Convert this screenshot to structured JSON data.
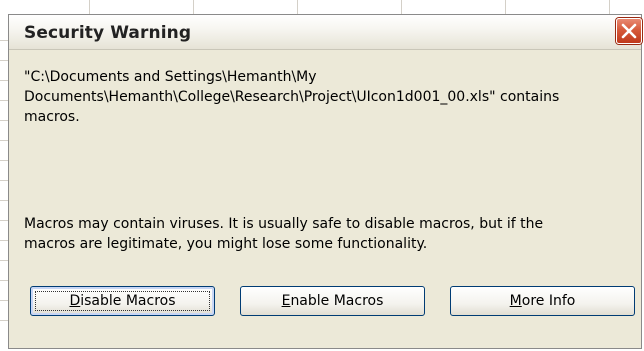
{
  "dialog": {
    "title": "Security Warning",
    "message": "\"C:\\Documents and Settings\\Hemanth\\My Documents\\Hemanth\\College\\Research\\Project\\UIcon1d001_00.xls\" contains macros.",
    "message_lines": [
      "\"C:\\Documents and Settings\\Hemanth\\My",
      "Documents\\Hemanth\\College\\Research\\Project\\UIcon1d001_00.xls\" contains",
      "macros."
    ],
    "warning_lines": [
      "Macros may contain viruses. It is usually safe to disable macros, but if the",
      "macros are legitimate, you might lose some functionality."
    ],
    "buttons": {
      "disable": {
        "accel": "D",
        "rest": "isable Macros"
      },
      "enable": {
        "accel": "E",
        "rest": "nable Macros"
      },
      "more_info": {
        "accel": "M",
        "rest": "ore Info"
      }
    },
    "close_icon": "close-icon",
    "colors": {
      "close_button": "#d65a3b",
      "dialog_bg": "#ece9d8",
      "button_border": "#003c74"
    }
  }
}
